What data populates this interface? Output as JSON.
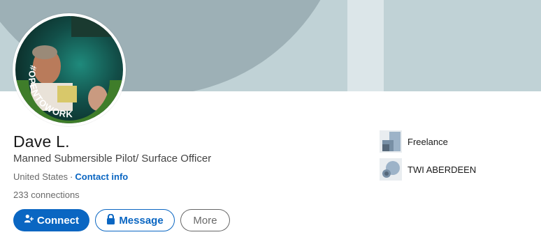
{
  "profile": {
    "name": "Dave L.",
    "headline": "Manned Submersible Pilot/ Surface Officer",
    "location": "United States",
    "separator": "·",
    "contact_label": "Contact info",
    "connections": "233 connections",
    "badge_text": "#OPENTOWORK"
  },
  "actions": {
    "connect_label": "Connect",
    "message_label": "Message",
    "more_label": "More"
  },
  "experience": [
    {
      "label": "Freelance",
      "icon": "company-logo-icon"
    },
    {
      "label": "TWI ABERDEEN",
      "icon": "school-logo-icon"
    }
  ],
  "colors": {
    "primary": "#0a66c2",
    "open_to_work": "#3f7d2a",
    "banner": "#c0d2d6"
  }
}
